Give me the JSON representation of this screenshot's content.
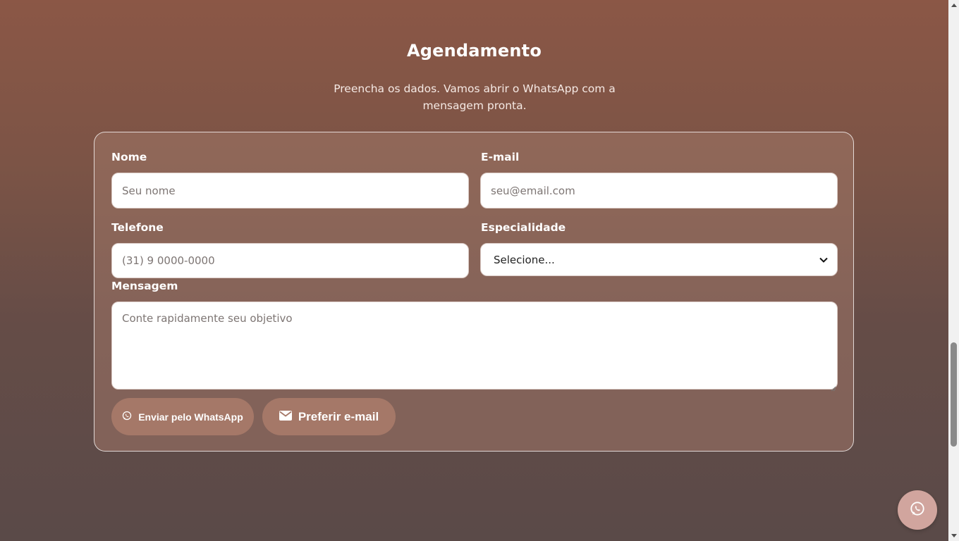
{
  "section": {
    "title": "Agendamento",
    "subtitle": "Preencha os dados. Vamos abrir o WhatsApp com a mensagem pronta."
  },
  "form": {
    "name_label": "Nome",
    "name_placeholder": "Seu nome",
    "email_label": "E-mail",
    "email_placeholder": "seu@email.com",
    "phone_label": "Telefone",
    "phone_placeholder": "(31) 9 0000-0000",
    "specialty_label": "Especialidade",
    "specialty_selected": "Selecione...",
    "message_label": "Mensagem",
    "message_placeholder": "Conte rapidamente seu objetivo",
    "whatsapp_button": "Enviar pelo WhatsApp",
    "email_button": "Preferir e-mail"
  },
  "icons": {
    "whatsapp": "whatsapp-icon",
    "envelope": "envelope-icon",
    "fab": "whatsapp-icon"
  },
  "colors": {
    "button_bg": "#a57868",
    "fab_bg": "#d1a59e",
    "card_border": "#ffffff"
  }
}
